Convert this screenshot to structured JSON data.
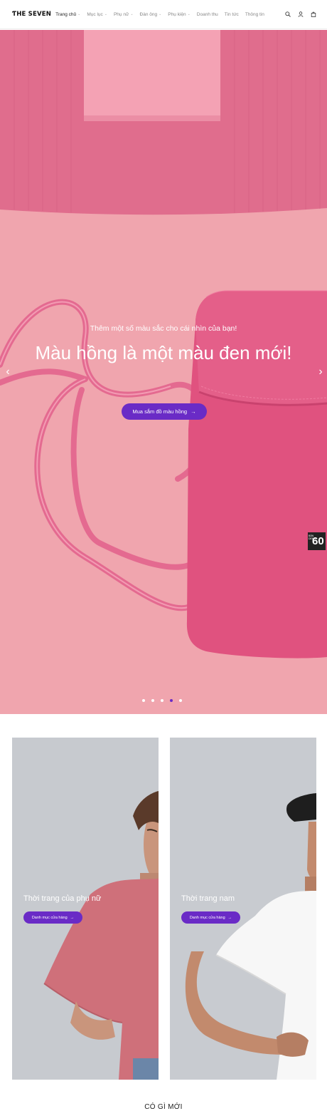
{
  "header": {
    "logo": "ƬHE SEVEN",
    "nav": [
      {
        "label": "Trang chủ",
        "has_dropdown": true,
        "active": true
      },
      {
        "label": "Mục lục",
        "has_dropdown": true
      },
      {
        "label": "Phụ nữ",
        "has_dropdown": true
      },
      {
        "label": "Đàn ông",
        "has_dropdown": true
      },
      {
        "label": "Phụ kiện",
        "has_dropdown": true
      },
      {
        "label": "Doanh thu"
      },
      {
        "label": "Tin tức"
      },
      {
        "label": "Thông tin"
      }
    ],
    "icons": [
      "search-icon",
      "user-icon",
      "cart-icon"
    ]
  },
  "hero": {
    "subtitle": "Thêm một số màu sắc cho cái nhìn của bạn!",
    "title": "Màu hồng là một màu đen mới!",
    "button_label": "Mua sắm đồ màu hồng",
    "slides_count": 5,
    "active_slide": 4,
    "badge_number": "60",
    "badge_small_text": "BẢN\nDEMO",
    "colors": {
      "accent": "#6a2bc6",
      "background_pink": "#f0a5ae",
      "sweater_pink": "#e06d8d",
      "bag_pink": "#e0527f"
    }
  },
  "cards": [
    {
      "title": "Thời trang của phụ nữ",
      "button_label": "Danh mục cửa hàng"
    },
    {
      "title": "Thời trang nam",
      "button_label": "Danh mục cửa hàng"
    }
  ],
  "section": {
    "title": "CÓ GÌ MỚI"
  }
}
